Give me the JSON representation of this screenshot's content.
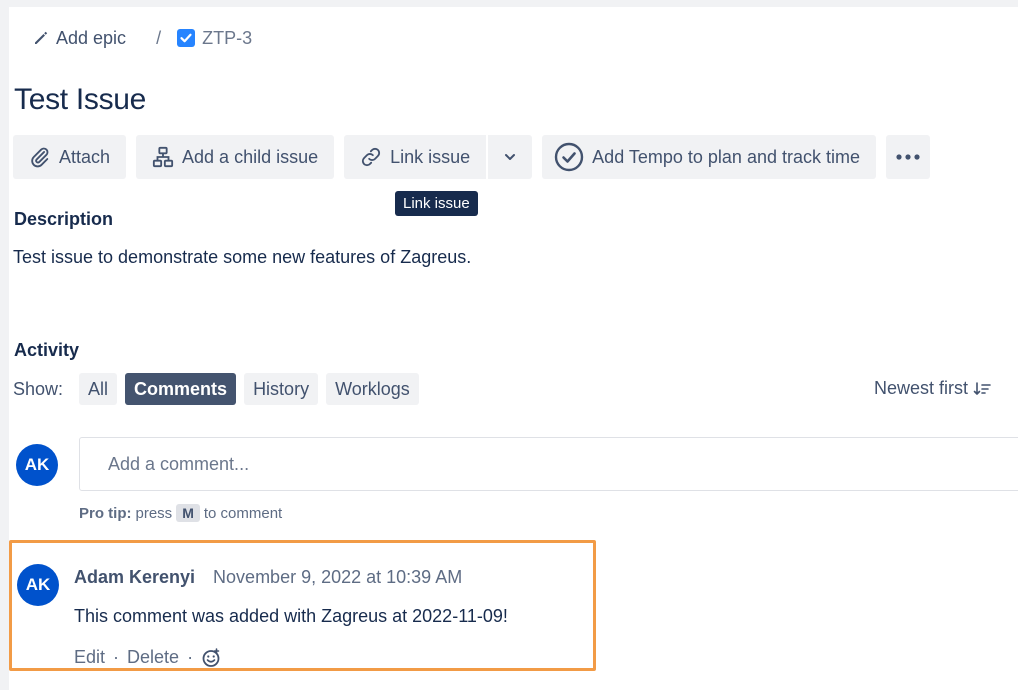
{
  "breadcrumb": {
    "epic_label": "Add epic",
    "separator": "/",
    "issue_key": "ZTP-3"
  },
  "issue": {
    "title": "Test Issue"
  },
  "toolbar": {
    "attach": "Attach",
    "add_child": "Add a child issue",
    "link_issue": "Link issue",
    "tempo": "Add Tempo to plan and track time"
  },
  "tooltip": {
    "text": "Link issue"
  },
  "description": {
    "heading": "Description",
    "text": "Test issue to demonstrate some new features of Zagreus."
  },
  "activity": {
    "heading": "Activity",
    "show_label": "Show:",
    "filters": [
      {
        "label": "All",
        "active": false
      },
      {
        "label": "Comments",
        "active": true
      },
      {
        "label": "History",
        "active": false
      },
      {
        "label": "Worklogs",
        "active": false
      }
    ],
    "sort_label": "Newest first"
  },
  "composer": {
    "avatar": "AK",
    "placeholder": "Add a comment...",
    "protip_label": "Pro tip:",
    "protip_press": "press",
    "protip_key": "M",
    "protip_suffix": "to comment"
  },
  "comment": {
    "avatar": "AK",
    "author": "Adam Kerenyi",
    "time": "November 9, 2022 at 10:39 AM",
    "body": "This comment was added with Zagreus at 2022-11-09!",
    "edit": "Edit",
    "delete": "Delete",
    "separator": "·"
  },
  "colors": {
    "avatar_bg": "#0052cc",
    "active_chip": "#44546f",
    "highlight_border": "#f29b46",
    "checkbox_blue": "#2684ff"
  },
  "icons": {
    "epic": "pencil-icon",
    "issue_type": "checkbox-icon",
    "attach": "paperclip-icon",
    "child": "hierarchy-icon",
    "link": "link-icon",
    "dropdown": "chevron-down-icon",
    "tempo": "check-circle-icon",
    "more": "more-icon",
    "sort": "sort-icon",
    "reaction": "smiley-icon"
  }
}
